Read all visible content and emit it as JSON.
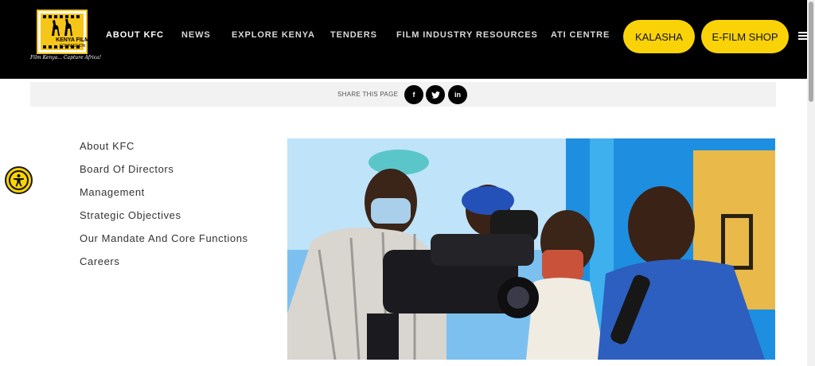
{
  "header": {
    "logo": {
      "name": "KENYA FILM",
      "sub": "COMMISSION",
      "tagline": "Film Kenya... Capture Africa!"
    },
    "nav": [
      {
        "label": "ABOUT KFC",
        "active": true
      },
      {
        "label": "NEWS",
        "active": false
      },
      {
        "label": "EXPLORE KENYA",
        "active": false
      },
      {
        "label": "TENDERS",
        "active": false
      },
      {
        "label": "FILM INDUSTRY RESOURCES",
        "active": false
      },
      {
        "label": "ATI CENTRE",
        "active": false
      }
    ],
    "buttons": {
      "kalasha": "KALASHA",
      "efilm": "E-FILM SHOP"
    },
    "menu_icon": "hamburger-icon"
  },
  "share": {
    "label": "SHARE THIS PAGE",
    "buttons": [
      {
        "icon": "facebook-icon",
        "glyph": "f"
      },
      {
        "icon": "twitter-icon",
        "glyph": "t"
      },
      {
        "icon": "linkedin-icon",
        "glyph": "in"
      }
    ]
  },
  "side_menu": [
    "About KFC",
    "Board Of Directors",
    "Management",
    "Strategic Objectives",
    "Our Mandate And Core Functions",
    "Careers"
  ],
  "accessibility_icon": "accessibility-icon",
  "colors": {
    "header_bg": "#000000",
    "accent": "#f9d307",
    "share_bg": "#f2f2f2",
    "menu_text": "#333333"
  }
}
